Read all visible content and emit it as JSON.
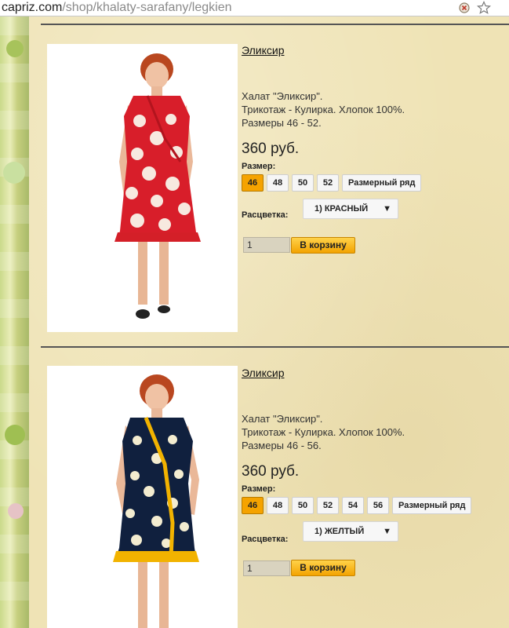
{
  "browser": {
    "url_host": "capriz.com",
    "url_path": "/shop/khalaty-sarafany/legkien"
  },
  "labels": {
    "size": "Размер:",
    "color": "Расцветка:",
    "add_to_cart": "В корзину"
  },
  "products": [
    {
      "name": "Эликсир",
      "desc_lines": [
        "Халат \"Эликсир\".",
        "Трикотаж - Кулирка. Хлопок 100%.",
        "Размеры 46 - 52."
      ],
      "price": "360 руб.",
      "sizes": [
        "46",
        "48",
        "50",
        "52"
      ],
      "active_size": "46",
      "size_chart": "Размерный ряд",
      "color": "1) КРАСНЫЙ",
      "quantity": "1",
      "palette": {
        "primary": "#d81e2a",
        "secondary": "#f7e9df",
        "trim": "#d41f28"
      }
    },
    {
      "name": "Эликсир",
      "desc_lines": [
        "Халат \"Эликсир\".",
        "Трикотаж - Кулирка. Хлопок 100%.",
        "Размеры 46 - 56."
      ],
      "price": "360 руб.",
      "sizes": [
        "46",
        "48",
        "50",
        "52",
        "54",
        "56"
      ],
      "active_size": "46",
      "size_chart": "Размерный ряд",
      "color": "1) ЖЕЛТЫЙ",
      "quantity": "1",
      "palette": {
        "primary": "#10203e",
        "secondary": "#f3ecd0",
        "trim": "#f2b300"
      }
    }
  ]
}
